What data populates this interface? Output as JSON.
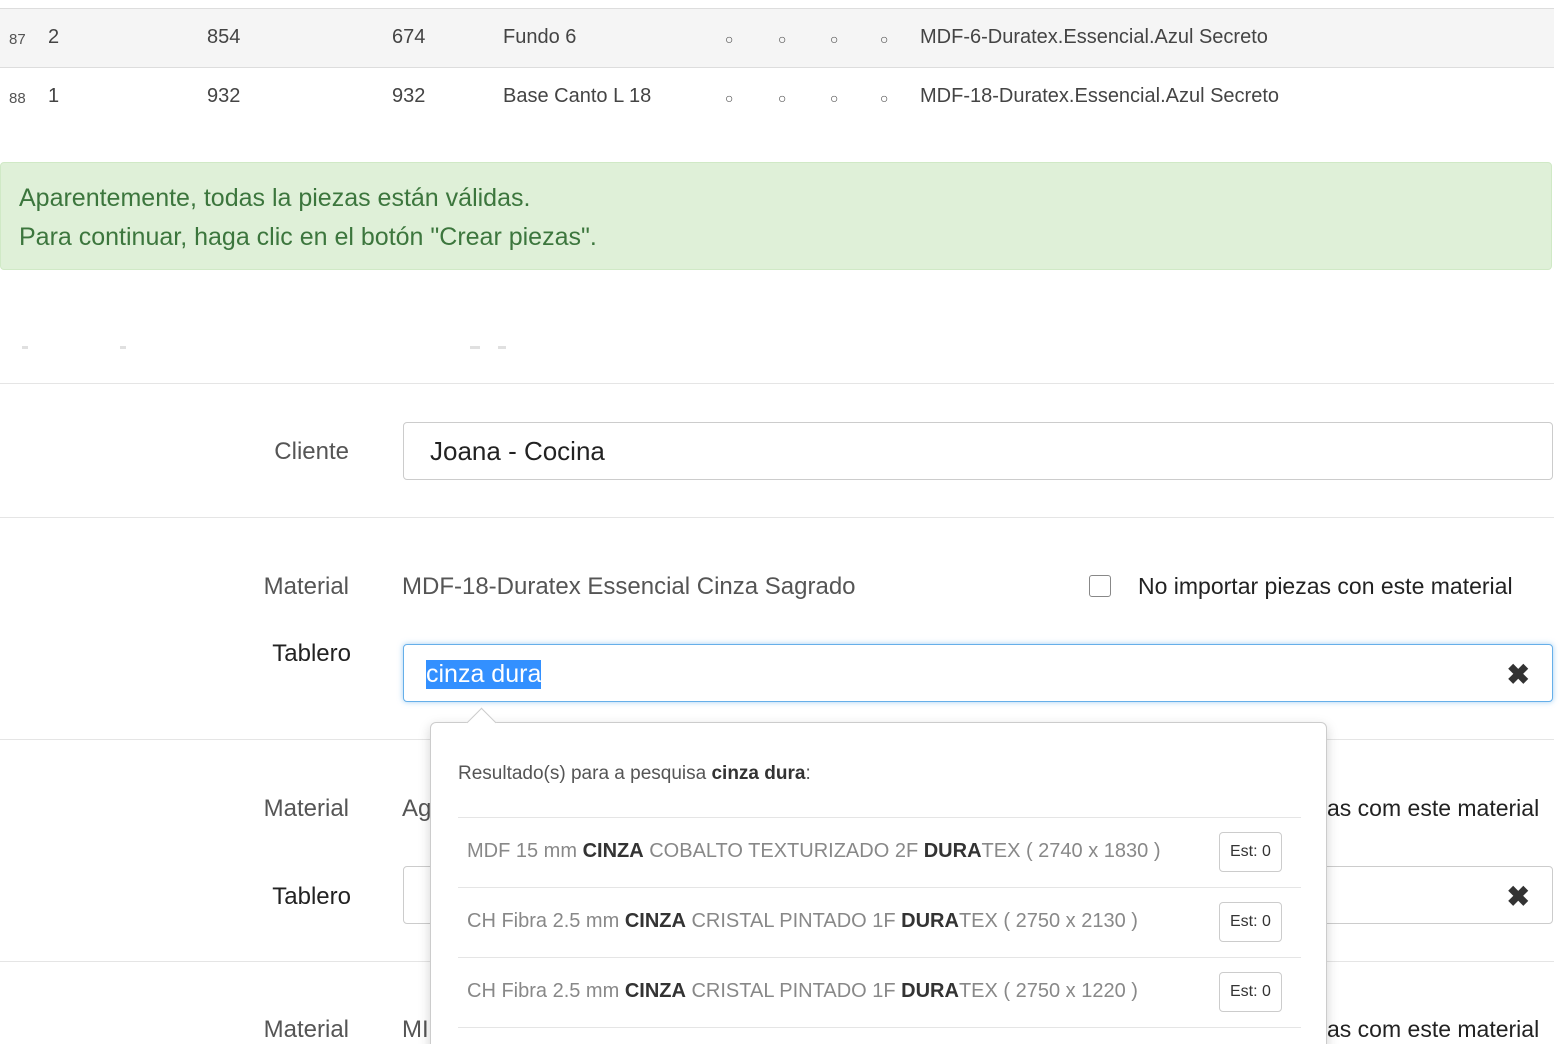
{
  "pieces_table": {
    "rows": [
      {
        "num": "87",
        "qty": "2",
        "width": "854",
        "height": "674",
        "description": "Fundo 6",
        "edges": [
          "○",
          "○",
          "○",
          "○"
        ],
        "material": "MDF-6-Duratex.Essencial.Azul Secreto"
      },
      {
        "num": "88",
        "qty": "1",
        "width": "932",
        "height": "932",
        "description": "Base Canto L 18",
        "edges": [
          "○",
          "○",
          "○",
          "○"
        ],
        "material": "MDF-18-Duratex.Essencial.Azul Secreto"
      }
    ]
  },
  "alert": {
    "line1": "Aparentemente, todas la piezas están válidas.",
    "line2": "Para continuar, haga clic en el botón \"Crear piezas\"."
  },
  "form": {
    "cliente_label": "Cliente",
    "cliente_value": "Joana - Cocina",
    "material_label": "Material",
    "tablero_label": "Tablero",
    "material_1": "MDF-18-Duratex Essencial Cinza Sagrado",
    "no_import_label": "No importar piezas con este material",
    "tablero_1_query": "cinza dura",
    "material_2_partial": "Ag",
    "no_import_label_partial": "as com este material",
    "material_3_partial": "MI",
    "clear_glyph": "✖"
  },
  "autocomplete": {
    "header_prefix": "Resultado(s) para a pesquisa",
    "header_query": "cinza dura",
    "header_suffix": ":",
    "results": [
      {
        "pre": "MDF 15 mm",
        "m1": "CINZA",
        "mid": "COBALTO TEXTURIZADO 2F",
        "m2": "DURA",
        "post": "TEX ( 2740 x 1830 )",
        "stock": "Est: 0"
      },
      {
        "pre": "CH Fibra 2.5 mm",
        "m1": "CINZA",
        "mid": "CRISTAL PINTADO 1F",
        "m2": "DURA",
        "post": "TEX ( 2750 x 2130 )",
        "stock": "Est: 0"
      },
      {
        "pre": "CH Fibra 2.5 mm",
        "m1": "CINZA",
        "mid": "CRISTAL PINTADO 1F",
        "m2": "DURA",
        "post": "TEX ( 2750 x 1220 )",
        "stock": "Est: 0"
      }
    ]
  },
  "colors": {
    "alert_bg": "#dff0d8",
    "alert_text": "#3c763d",
    "focus_border": "#66afe9",
    "selection": "#3390ff"
  }
}
